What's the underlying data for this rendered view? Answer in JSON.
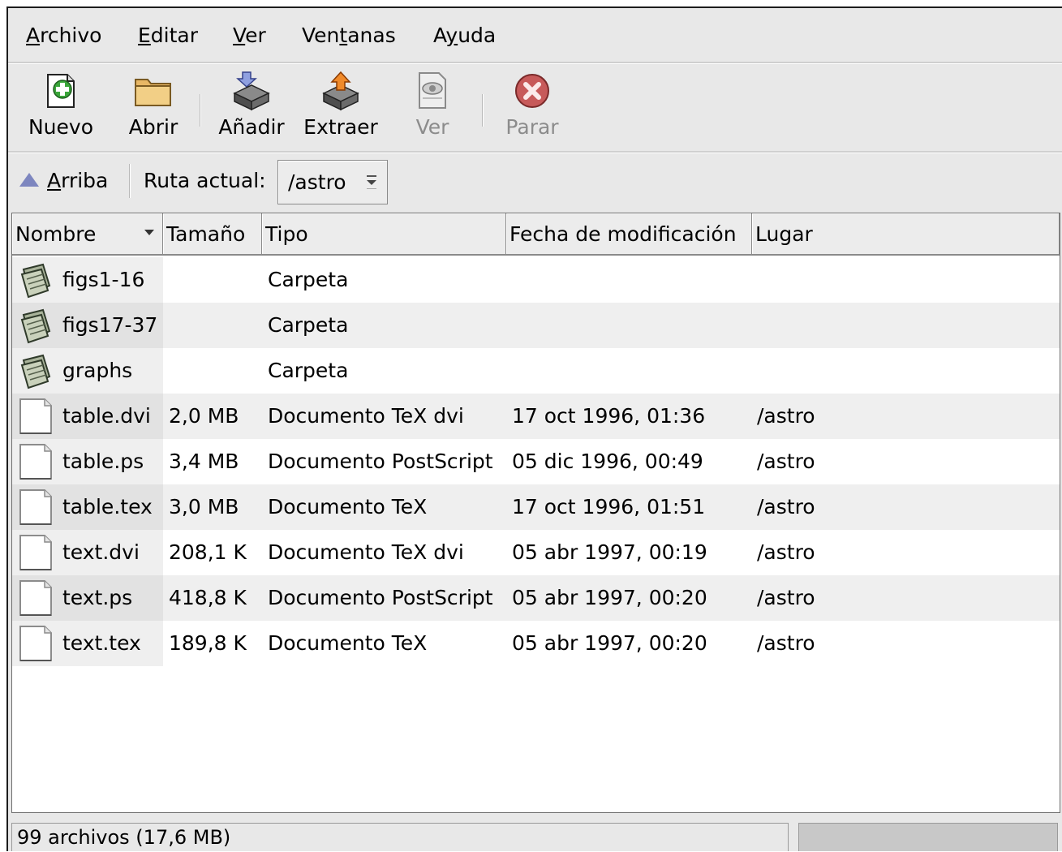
{
  "menubar": {
    "items": [
      {
        "pre": "",
        "key": "A",
        "post": "rchivo"
      },
      {
        "pre": "",
        "key": "E",
        "post": "ditar"
      },
      {
        "pre": "",
        "key": "V",
        "post": "er"
      },
      {
        "pre": "Ven",
        "key": "t",
        "post": "anas"
      },
      {
        "pre": "A",
        "key": "y",
        "post": "uda"
      }
    ]
  },
  "toolbar": {
    "nuevo": "Nuevo",
    "abrir": "Abrir",
    "anadir": "Añadir",
    "extraer": "Extraer",
    "ver": "Ver",
    "parar": "Parar"
  },
  "location": {
    "up_key": "A",
    "up_rest": "rriba",
    "label": "Ruta actual:",
    "path": "/astro"
  },
  "columns": [
    "Nombre",
    "Tamaño",
    "Tipo",
    "Fecha de modificación",
    "Lugar"
  ],
  "files": [
    {
      "name": "figs1-16",
      "size": "",
      "type": "Carpeta",
      "date": "",
      "place": "",
      "icon": "folder-icon"
    },
    {
      "name": "figs17-37",
      "size": "",
      "type": "Carpeta",
      "date": "",
      "place": "",
      "icon": "folder-icon"
    },
    {
      "name": "graphs",
      "size": "",
      "type": "Carpeta",
      "date": "",
      "place": "",
      "icon": "folder-icon"
    },
    {
      "name": "table.dvi",
      "size": "2,0 MB",
      "type": "Documento TeX dvi",
      "date": "17 oct 1996, 01:36",
      "place": "/astro",
      "icon": "document-icon"
    },
    {
      "name": "table.ps",
      "size": "3,4 MB",
      "type": "Documento PostScript",
      "date": "05 dic 1996, 00:49",
      "place": "/astro",
      "icon": "document-icon"
    },
    {
      "name": "table.tex",
      "size": "3,0 MB",
      "type": "Documento TeX",
      "date": "17 oct 1996, 01:51",
      "place": "/astro",
      "icon": "document-icon"
    },
    {
      "name": "text.dvi",
      "size": "208,1 K",
      "type": "Documento TeX dvi",
      "date": "05 abr 1997, 00:19",
      "place": "/astro",
      "icon": "document-icon"
    },
    {
      "name": "text.ps",
      "size": "418,8 K",
      "type": "Documento PostScript",
      "date": "05 abr 1997, 00:20",
      "place": "/astro",
      "icon": "document-icon"
    },
    {
      "name": "text.tex",
      "size": "189,8 K",
      "type": "Documento TeX",
      "date": "05 abr 1997, 00:20",
      "place": "/astro",
      "icon": "document-icon"
    }
  ],
  "status": {
    "text": "99 archivos (17,6 MB)"
  }
}
